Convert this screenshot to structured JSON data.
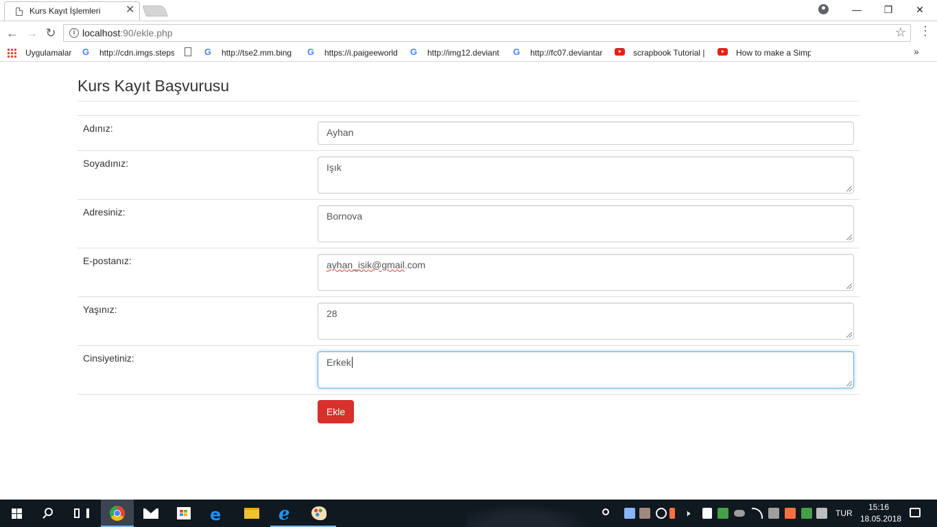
{
  "browser": {
    "tab_title": "Kurs Kayıt İşlemleri",
    "tab_close": "✕",
    "url_host": "localhost",
    "url_path": ":90/ekle.php",
    "bookmarks": [
      {
        "label": "Uygulamalar",
        "icon": "apps-icon"
      },
      {
        "label": "http://cdn.imgs.steps",
        "icon": "google-icon"
      },
      {
        "label": "http://tse2.mm.bing",
        "icon": "page-icon"
      },
      {
        "label": "https://i.paigeeworld",
        "icon": "google-icon"
      },
      {
        "label": "http://img12.deviant",
        "icon": "google-icon"
      },
      {
        "label": "http://fc07.deviantar",
        "icon": "google-icon"
      },
      {
        "label": "scrapbook Tutorial |",
        "icon": "youtube-icon"
      },
      {
        "label": "How to make a Simp",
        "icon": "youtube-icon"
      }
    ],
    "bookmarks_more": "»"
  },
  "page": {
    "title": "Kurs Kayıt Başvurusu",
    "fields": [
      {
        "label": "Adınız:",
        "value": "Ayhan"
      },
      {
        "label": "Soyadınız:",
        "value": "Işık"
      },
      {
        "label": "Adresiniz:",
        "value": "Bornova"
      },
      {
        "label": "E-postanız:",
        "value_underlined": "ayhan_isik@gmail",
        "value_rest": ".com"
      },
      {
        "label": "Yaşınız:",
        "value": "28"
      },
      {
        "label": "Cinsiyetiniz:",
        "value": "Erkek"
      }
    ],
    "submit_label": "Ekle"
  },
  "taskbar": {
    "language": "TUR",
    "time": "15:16",
    "date": "18.05.2018"
  },
  "colors": {
    "accent_button": "#d9302c",
    "focus_border": "#66afe9",
    "taskbar_bg": "#101820"
  }
}
